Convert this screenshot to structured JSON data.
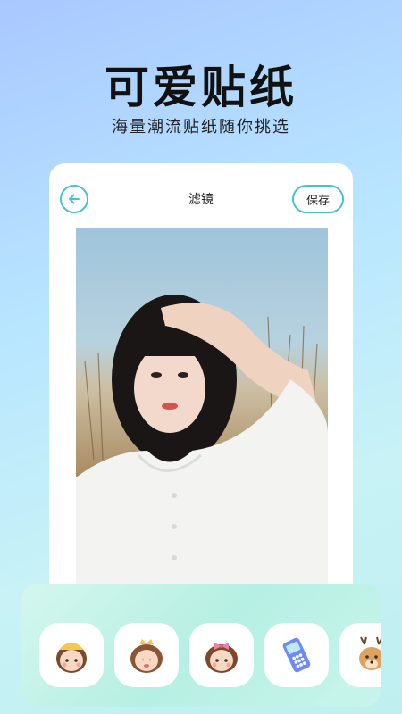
{
  "header": {
    "title": "可爱贴纸",
    "subtitle": "海量潮流贴纸随你挑选"
  },
  "editor": {
    "title": "滤镜",
    "save_label": "保存"
  },
  "colors": {
    "accent": "#47c2cf"
  },
  "stickers": [
    {
      "icon": "girl-yellow-hat-sticker-icon"
    },
    {
      "icon": "girl-crown-sticker-icon"
    },
    {
      "icon": "girl-pink-bow-sticker-icon"
    },
    {
      "icon": "phone-sticker-icon"
    },
    {
      "icon": "deer-sticker-icon"
    }
  ]
}
